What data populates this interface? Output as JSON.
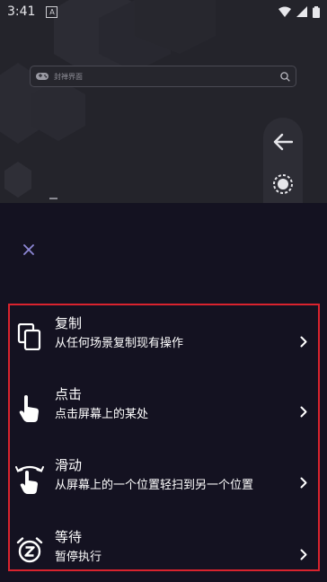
{
  "status_bar": {
    "time": "3:41",
    "notification_badge": "A"
  },
  "search": {
    "placeholder": "封禅界面"
  },
  "sheet": {
    "actions": [
      {
        "icon": "copy-icon",
        "title": "复制",
        "description": "从任何场景复制现有操作"
      },
      {
        "icon": "tap-icon",
        "title": "点击",
        "description": "点击屏幕上的某处"
      },
      {
        "icon": "swipe-icon",
        "title": "滑动",
        "description": "从屏幕上的一个位置轻扫到另一个位置"
      },
      {
        "icon": "alarm-z-icon",
        "title": "等待",
        "description": "暂停执行"
      }
    ]
  },
  "colors": {
    "sheet_background": "#141221",
    "app_background": "#24242b",
    "highlight_border": "#d9232e",
    "close_icon": "#8e87d6"
  }
}
